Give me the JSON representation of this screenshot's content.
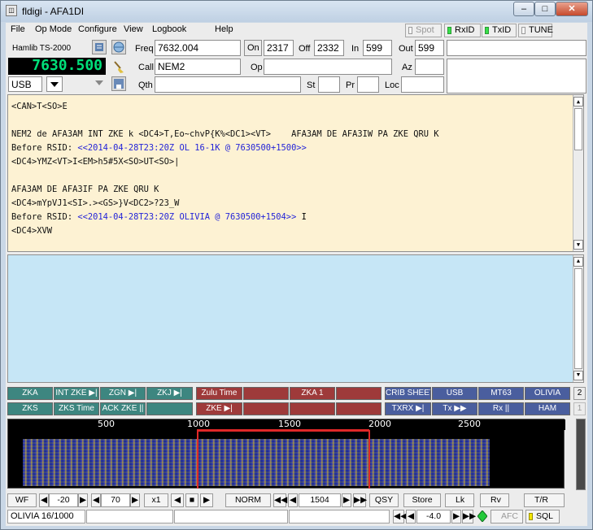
{
  "window": {
    "title": "fldigi - AFA1DI",
    "minimize": "–",
    "maximize": "□",
    "close": "✕"
  },
  "menu": [
    "File",
    "Op Mode",
    "Configure",
    "View",
    "Logbook",
    "Help"
  ],
  "toggles": {
    "spot": "Spot",
    "rxid": "RxID",
    "txid": "TxID",
    "tune": "TUNE"
  },
  "rig": {
    "name": "Hamlib TS-2000",
    "frequency_display": "7630.500",
    "mode": "USB"
  },
  "log": {
    "freq_label": "Freq",
    "freq": "7632.004",
    "on_label": "On",
    "on": "2317",
    "off_label": "Off",
    "off": "2332",
    "in_label": "In",
    "in": "599",
    "out_label": "Out",
    "out": "599",
    "call_label": "Call",
    "call": "NEM2",
    "op_label": "Op",
    "op": "",
    "az_label": "Az",
    "az": "",
    "qth_label": "Qth",
    "qth": "",
    "st_label": "St",
    "st": "",
    "pr_label": "Pr",
    "pr": "",
    "loc_label": "Loc",
    "loc": ""
  },
  "rx_text": [
    {
      "text": "<CAN>T<SO>E",
      "blue": ""
    },
    {
      "text": "",
      "blue": ""
    },
    {
      "text": "NEM2 de AFA3AM INT ZKE k <DC4>T,Eo~chvP{K%<DC1><VT>    AFA3AM DE AFA3IW PA ZKE QRU K",
      "blue": ""
    },
    {
      "text": "Before RSID: ",
      "blue": "<<2014-04-28T23:20Z OL 16-1K @ 7630500+1500>>"
    },
    {
      "text": "<DC4>YMZ<VT>I<EM>h5#5X<SO>UT<SO>|",
      "blue": ""
    },
    {
      "text": "",
      "blue": ""
    },
    {
      "text": "AFA3AM DE AFA3IF PA ZKE QRU K",
      "blue": ""
    },
    {
      "text": "<DC4>mYpVJ1<SI>.><GS>}V<DC2>?23_W",
      "blue": ""
    },
    {
      "text": "Before RSID: ",
      "blue": "<<2014-04-28T23:20Z OLIVIA @ 7630500+1504>>"
    },
    {
      "text": "<DC4>XVW",
      "blue": ""
    }
  ],
  "macros_row1": [
    "ZKA",
    "INT ZKE ▶|",
    "ZGN ▶|",
    "ZKJ ▶|",
    "Zulu Time",
    "",
    "ZKA 1",
    "",
    "CRIB SHEET",
    "USB",
    "MT63",
    "OLIVIA"
  ],
  "macros_row2": [
    "ZKS",
    "ZKS Time",
    "ACK ZKE ||",
    "",
    "ZKE ▶|",
    "",
    "",
    "",
    "TXRX ▶|",
    "Tx ▶▶",
    "Rx ||",
    "HAM"
  ],
  "macro_set_1": "2",
  "macro_set_2": "1",
  "scale": [
    "500",
    "1000",
    "1500",
    "2000",
    "2500"
  ],
  "wf_controls": {
    "wf": "WF",
    "level": "-20",
    "range": "70",
    "zoom": "x1",
    "norm": "NORM",
    "carrier": "1504",
    "qsy": "QSY",
    "store": "Store",
    "lk": "Lk",
    "rv": "Rv",
    "tr": "T/R"
  },
  "status": {
    "mode": "OLIVIA 16/1000",
    "squelch": "-4.0",
    "afc": "AFC",
    "sql": "SQL"
  }
}
